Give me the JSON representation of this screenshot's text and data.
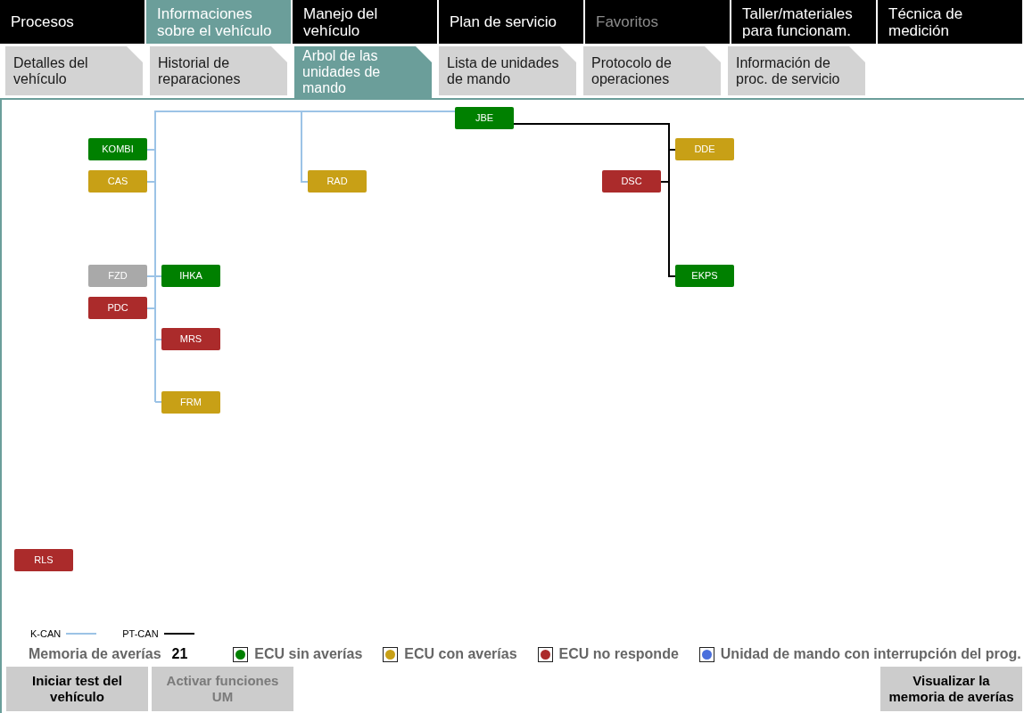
{
  "main_tabs": [
    {
      "label": "Procesos",
      "selected": false,
      "disabled": false
    },
    {
      "label": "Informaciones sobre el vehículo",
      "selected": true,
      "disabled": false
    },
    {
      "label": "Manejo del vehículo",
      "selected": false,
      "disabled": false
    },
    {
      "label": "Plan de servicio",
      "selected": false,
      "disabled": false
    },
    {
      "label": "Favoritos",
      "selected": false,
      "disabled": true
    },
    {
      "label": "Taller/materiales para funcionam.",
      "selected": false,
      "disabled": false
    },
    {
      "label": "Técnica de medición",
      "selected": false,
      "disabled": false
    }
  ],
  "sub_tabs": [
    {
      "label": "Detalles del vehículo",
      "selected": false
    },
    {
      "label": "Historial de reparaciones",
      "selected": false
    },
    {
      "label": "Arbol de las unidades de mando",
      "selected": true
    },
    {
      "label": "Lista de unidades de mando",
      "selected": false
    },
    {
      "label": "Protocolo de operaciones",
      "selected": false
    },
    {
      "label": "Información de proc. de servicio",
      "selected": false
    }
  ],
  "ecu_tree": {
    "nodes": [
      {
        "label": "JBE",
        "color": "#008000"
      },
      {
        "label": "KOMBI",
        "color": "#008000"
      },
      {
        "label": "DDE",
        "color": "#c8a016"
      },
      {
        "label": "CAS",
        "color": "#c8a016"
      },
      {
        "label": "RAD",
        "color": "#c8a016"
      },
      {
        "label": "DSC",
        "color": "#ab2b2b"
      },
      {
        "label": "FZD",
        "color": "#a9a9a9"
      },
      {
        "label": "IHKA",
        "color": "#008000"
      },
      {
        "label": "EKPS",
        "color": "#008000"
      },
      {
        "label": "PDC",
        "color": "#ab2b2b"
      },
      {
        "label": "MRS",
        "color": "#ab2b2b"
      },
      {
        "label": "FRM",
        "color": "#c8a016"
      },
      {
        "label": "RLS",
        "color": "#ab2b2b"
      }
    ]
  },
  "bus_legend": [
    {
      "label": "K-CAN",
      "color": "#9cc3e6"
    },
    {
      "label": "PT-CAN",
      "color": "#000000"
    }
  ],
  "fault_memory": {
    "label": "Memoria de averías",
    "count": "21"
  },
  "status_legend": [
    {
      "label": "ECU sin averías",
      "color": "#008000"
    },
    {
      "label": "ECU con averías",
      "color": "#c8a016"
    },
    {
      "label": "ECU no responde",
      "color": "#ab2b2b"
    },
    {
      "label": "Unidad de mando con interrupción del prog.",
      "color": "#4a6fdc"
    }
  ],
  "buttons": [
    {
      "label": "Iniciar test del vehículo",
      "disabled": false
    },
    {
      "label": "Activar funciones UM",
      "disabled": true
    },
    {
      "label": "Visualizar la memoria de averías",
      "disabled": false
    }
  ]
}
